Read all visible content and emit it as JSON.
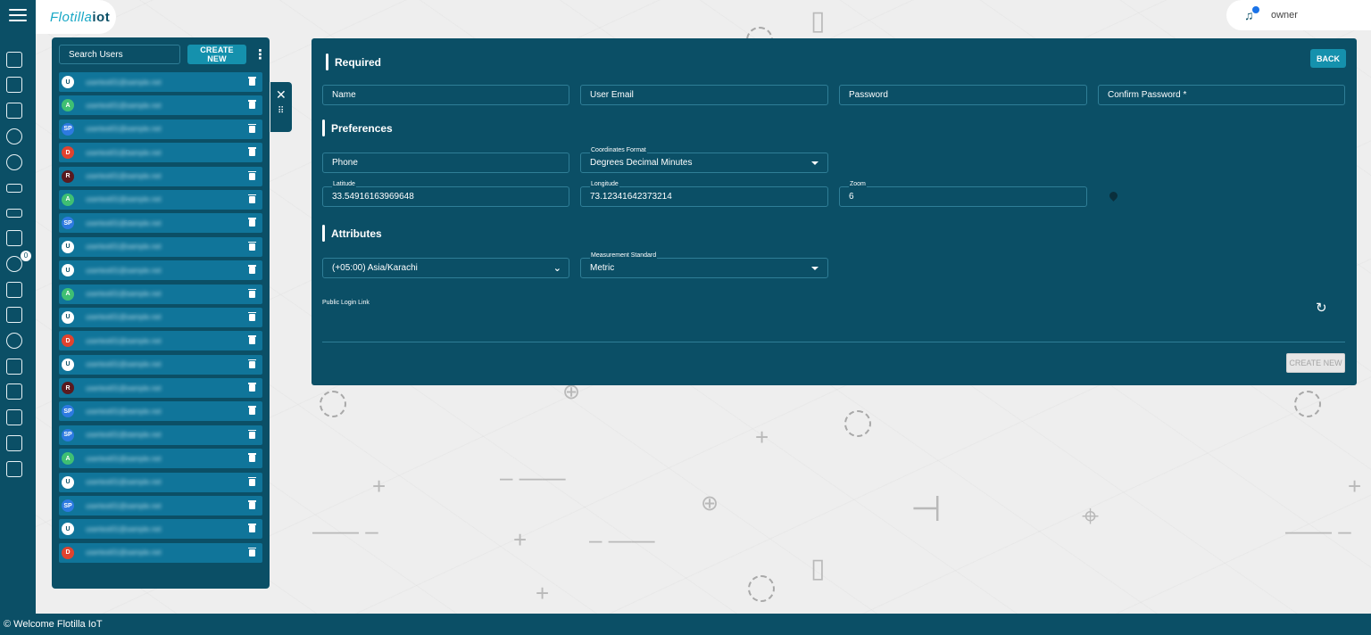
{
  "header": {
    "logo_text": "Flotilla",
    "logo_suffix": "iot",
    "user_name": "owner",
    "notification_count": "0"
  },
  "users_panel": {
    "search_placeholder": "Search Users",
    "create_label": "CREATE NEW",
    "users": [
      {
        "initials": "U",
        "color": "#ffffff",
        "text_color": "#0b4f66",
        "email": "usertest01@sample.net"
      },
      {
        "initials": "A",
        "color": "#3fbf73",
        "text_color": "#ffffff",
        "email": "usertest01@sample.net"
      },
      {
        "initials": "SP",
        "color": "#2d7ae0",
        "text_color": "#ffffff",
        "email": "usertest01@sample.net"
      },
      {
        "initials": "D",
        "color": "#e0432f",
        "text_color": "#ffffff",
        "email": "usertest01@sample.net"
      },
      {
        "initials": "R",
        "color": "#5a1a1f",
        "text_color": "#ffffff",
        "email": "usertest01@sample.net"
      },
      {
        "initials": "A",
        "color": "#3fbf73",
        "text_color": "#ffffff",
        "email": "usertest01@sample.net"
      },
      {
        "initials": "SP",
        "color": "#2d7ae0",
        "text_color": "#ffffff",
        "email": "usertest01@sample.net"
      },
      {
        "initials": "U",
        "color": "#ffffff",
        "text_color": "#0b4f66",
        "email": "usertest01@sample.net"
      },
      {
        "initials": "U",
        "color": "#ffffff",
        "text_color": "#0b4f66",
        "email": "usertest01@sample.net"
      },
      {
        "initials": "A",
        "color": "#3fbf73",
        "text_color": "#ffffff",
        "email": "usertest01@sample.net"
      },
      {
        "initials": "U",
        "color": "#ffffff",
        "text_color": "#0b4f66",
        "email": "usertest01@sample.net"
      },
      {
        "initials": "D",
        "color": "#e0432f",
        "text_color": "#ffffff",
        "email": "usertest01@sample.net"
      },
      {
        "initials": "U",
        "color": "#ffffff",
        "text_color": "#0b4f66",
        "email": "usertest01@sample.net"
      },
      {
        "initials": "R",
        "color": "#5a1a1f",
        "text_color": "#ffffff",
        "email": "usertest01@sample.net"
      },
      {
        "initials": "SP",
        "color": "#2d7ae0",
        "text_color": "#ffffff",
        "email": "usertest01@sample.net"
      },
      {
        "initials": "SP",
        "color": "#2d7ae0",
        "text_color": "#ffffff",
        "email": "usertest01@sample.net"
      },
      {
        "initials": "A",
        "color": "#3fbf73",
        "text_color": "#ffffff",
        "email": "usertest01@sample.net"
      },
      {
        "initials": "U",
        "color": "#ffffff",
        "text_color": "#0b4f66",
        "email": "usertest01@sample.net"
      },
      {
        "initials": "SP",
        "color": "#2d7ae0",
        "text_color": "#ffffff",
        "email": "usertest01@sample.net"
      },
      {
        "initials": "U",
        "color": "#ffffff",
        "text_color": "#0b4f66",
        "email": "usertest01@sample.net"
      },
      {
        "initials": "D",
        "color": "#e0432f",
        "text_color": "#ffffff",
        "email": "usertest01@sample.net"
      }
    ]
  },
  "form": {
    "back_label": "BACK",
    "required_title": "Required",
    "name_placeholder": "Name",
    "email_placeholder": "User Email",
    "password_placeholder": "Password",
    "confirm_password_placeholder": "Confirm Password *",
    "preferences_title": "Preferences",
    "phone_placeholder": "Phone",
    "coordinates_label": "Coordinates Format",
    "coordinates_value": "Degrees Decimal Minutes",
    "latitude_label": "Latitude",
    "latitude_value": "33.54916163969648",
    "longitude_label": "Longitude",
    "longitude_value": "73.12341642373214",
    "zoom_label": "Zoom",
    "zoom_value": "6",
    "attributes_title": "Attributes",
    "timezone_value": "(+05:00) Asia/Karachi",
    "measurement_label": "Measurement Standard",
    "measurement_value": "Metric",
    "public_login_label": "Public Login Link",
    "create_new_label": "CREATE NEW"
  },
  "footer": {
    "text": "© Welcome Flotilla IoT"
  },
  "colors": {
    "primary": "#0b4f66",
    "accent": "#1591ad",
    "row": "#10759a"
  }
}
